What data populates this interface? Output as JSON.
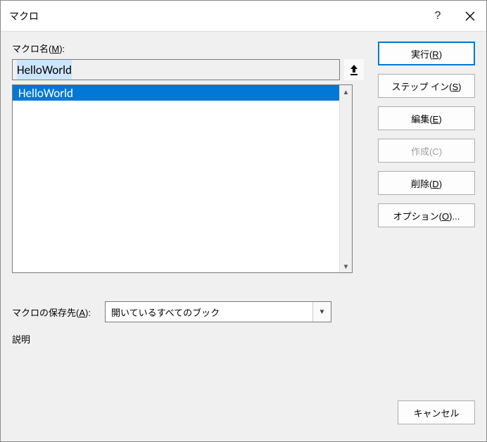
{
  "titlebar": {
    "title": "マクロ"
  },
  "labels": {
    "macro_name_prefix": "マクロ名(",
    "macro_name_u": "M",
    "macro_name_suffix": "):",
    "store_prefix": "マクロの保存先(",
    "store_u": "A",
    "store_suffix": "):",
    "description": "説明"
  },
  "macro_name": {
    "value": "HelloWorld"
  },
  "list": {
    "items": [
      "HelloWorld"
    ],
    "selected": 0
  },
  "store": {
    "selected": "開いているすべてのブック"
  },
  "buttons": {
    "run": {
      "pre": "実行(",
      "u": "R",
      "post": ")"
    },
    "step": {
      "pre": "ステップ イン(",
      "u": "S",
      "post": ")"
    },
    "edit": {
      "pre": "編集(",
      "u": "E",
      "post": ")"
    },
    "create": {
      "pre": "作成(",
      "u": "C",
      "post": ")"
    },
    "delete": {
      "pre": "削除(",
      "u": "D",
      "post": ")"
    },
    "options": {
      "pre": "オプション(",
      "u": "O",
      "post": ")..."
    },
    "cancel": "キャンセル"
  }
}
